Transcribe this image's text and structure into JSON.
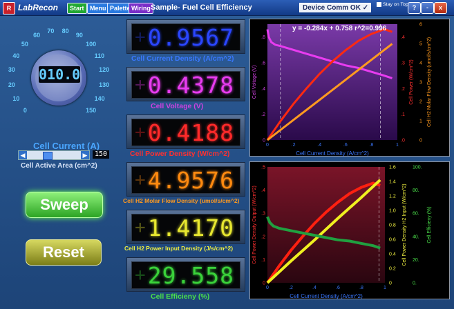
{
  "window": {
    "app_title": "LabRecon",
    "logo_text": "R",
    "doc_title": "Sample- Fuel Cell Efficiency",
    "buttons": [
      {
        "label": "Start",
        "color": "#22a832"
      },
      {
        "label": "Menu",
        "color": "#2a7ae0"
      },
      {
        "label": "Palette",
        "color": "#2a7ae0"
      },
      {
        "label": "Wiring",
        "color": "#7a2ec8"
      }
    ],
    "device_comm": "Device Comm OK ✓",
    "stay_on_top": "Stay on Top",
    "window_buttons": [
      "?",
      "-",
      "x"
    ]
  },
  "dial": {
    "ticks": [
      "0",
      "10",
      "20",
      "30",
      "40",
      "50",
      "60",
      "70",
      "80",
      "90",
      "100",
      "110",
      "120",
      "130",
      "140",
      "150"
    ],
    "display": "010.0",
    "label": "Cell Current (A)"
  },
  "area": {
    "value": "150",
    "label": "Cell Active Area (cm^2)",
    "slider_fraction": 0.35
  },
  "sweep_label": "Sweep",
  "reset_label": "Reset",
  "displays": [
    {
      "value": "0.9567",
      "label": "Cell Current Density (A/cm^2)",
      "color": "#2a46ff",
      "label_color": "#3a78ff"
    },
    {
      "value": "0.4378",
      "label": "Cell Voltage (V)",
      "color": "#e83cf0",
      "label_color": "#d040e0"
    },
    {
      "value": "0.4188",
      "label": "Cell Power Density (W/cm^2)",
      "color": "#ff2a2a",
      "label_color": "#ff3030"
    },
    {
      "value": "4.9576",
      "label": "Cell H2 Molar Flow Density (umol/s/cm^2)",
      "color": "#ff8a10",
      "label_color": "#ff9a20"
    },
    {
      "value": "1.4170",
      "label": "Cell H2 Power Input Density (J/s/cm^2)",
      "color": "#e8e830",
      "label_color": "#f0f040"
    },
    {
      "value": "29.558",
      "label": "Cell Efficieny (%)",
      "color": "#3ad23a",
      "label_color": "#4ae04a"
    }
  ],
  "chart_data": [
    {
      "type": "line",
      "xlabel": "Cell Current Density (A/cm^2)",
      "x_ticks": [
        "0",
        ".2",
        ".4",
        ".6",
        ".8",
        "1"
      ],
      "xlim": [
        0,
        1
      ],
      "annotation": "y = -0.284x + 0.758     r^2=0.996",
      "y_axes": [
        {
          "label": "Cell Voltage (V)",
          "side": "left",
          "ticks": [
            "0",
            ".2",
            ".4",
            ".6",
            ".8"
          ],
          "ylim": [
            0,
            0.9
          ],
          "color": "#d040e0"
        },
        {
          "label": "Cell Power (W/cm^2)",
          "side": "right",
          "ticks": [
            ".0",
            ".1",
            ".2",
            ".3",
            ".4"
          ],
          "ylim": [
            0,
            0.45
          ],
          "color": "#ff3030"
        },
        {
          "label": "Cell H2 Molar Flow Density (umol/s/cm^2)",
          "side": "right",
          "ticks": [
            "0",
            "1",
            "2",
            "3",
            "4",
            "5",
            "6"
          ],
          "ylim": [
            0,
            6
          ],
          "color": "#ff9a20"
        }
      ],
      "series": [
        {
          "name": "Cell Voltage (V)",
          "color": "#e83cf0",
          "axis": 0,
          "x": [
            0,
            0.01,
            0.03,
            0.06,
            0.1,
            0.2,
            0.3,
            0.4,
            0.5,
            0.6,
            0.7,
            0.8,
            0.9,
            0.96
          ],
          "y": [
            0.86,
            0.8,
            0.76,
            0.74,
            0.73,
            0.7,
            0.67,
            0.64,
            0.61,
            0.58,
            0.56,
            0.53,
            0.5,
            0.48
          ]
        },
        {
          "name": "Cell Power (W/cm^2)",
          "color": "#ff2a10",
          "axis": 1,
          "x": [
            0,
            0.1,
            0.2,
            0.3,
            0.4,
            0.5,
            0.6,
            0.7,
            0.8,
            0.9,
            0.96
          ],
          "y": [
            0,
            0.073,
            0.14,
            0.2,
            0.256,
            0.305,
            0.348,
            0.385,
            0.412,
            0.43,
            0.42
          ]
        },
        {
          "name": "Cell H2 Molar Flow Density (umol/s/cm^2)",
          "color": "#ff9a20",
          "axis": 2,
          "x": [
            0,
            0.2,
            0.4,
            0.6,
            0.8,
            0.96
          ],
          "y": [
            0,
            1.04,
            2.07,
            3.11,
            4.15,
            4.98
          ]
        }
      ]
    },
    {
      "type": "line",
      "xlabel": "Cell Current Density (A/cm^2)",
      "x_ticks": [
        "0",
        ".2",
        ".4",
        ".6",
        ".8",
        "1"
      ],
      "xlim": [
        0,
        1
      ],
      "y_axes": [
        {
          "label": "Cell Power Density Output (W/cm^2)",
          "side": "left",
          "ticks": [
            "0",
            ".1",
            ".2",
            ".3",
            ".4",
            ".5"
          ],
          "ylim": [
            0,
            0.5
          ],
          "color": "#ff3030"
        },
        {
          "label": "Cell Power Density H2 Input (W/cm^2)",
          "side": "right",
          "ticks": [
            "0",
            "0.2",
            "0.4",
            "0.6",
            "0.8",
            "1.0",
            "1.2",
            "1.4",
            "1.6"
          ],
          "ylim": [
            0,
            1.6
          ],
          "color": "#f0f040"
        },
        {
          "label": "Cell Efficieny (%)",
          "side": "right",
          "ticks": [
            "0.",
            "20.",
            "40.",
            "60.",
            "80.",
            "100."
          ],
          "ylim": [
            0,
            100
          ],
          "color": "#4ae04a"
        }
      ],
      "series": [
        {
          "name": "Cell Power Density Output (W/cm^2)",
          "color": "#ff2010",
          "axis": 0,
          "x": [
            0,
            0.1,
            0.2,
            0.3,
            0.4,
            0.5,
            0.6,
            0.7,
            0.8,
            0.9,
            0.96
          ],
          "y": [
            0,
            0.073,
            0.14,
            0.2,
            0.256,
            0.305,
            0.348,
            0.385,
            0.412,
            0.43,
            0.42
          ]
        },
        {
          "name": "Cell Power Density H2 Input (W/cm^2)",
          "color": "#f0f020",
          "axis": 1,
          "x": [
            0,
            0.2,
            0.4,
            0.6,
            0.8,
            0.96
          ],
          "y": [
            0,
            0.3,
            0.59,
            0.89,
            1.18,
            1.42
          ]
        },
        {
          "name": "Cell Efficieny (%)",
          "color": "#20a040",
          "axis": 2,
          "x": [
            0,
            0.02,
            0.05,
            0.1,
            0.2,
            0.3,
            0.4,
            0.5,
            0.6,
            0.7,
            0.8,
            0.9,
            0.96
          ],
          "y": [
            57,
            52,
            49,
            47,
            45,
            43,
            41,
            39,
            37,
            36,
            34,
            32,
            30
          ]
        }
      ]
    }
  ]
}
